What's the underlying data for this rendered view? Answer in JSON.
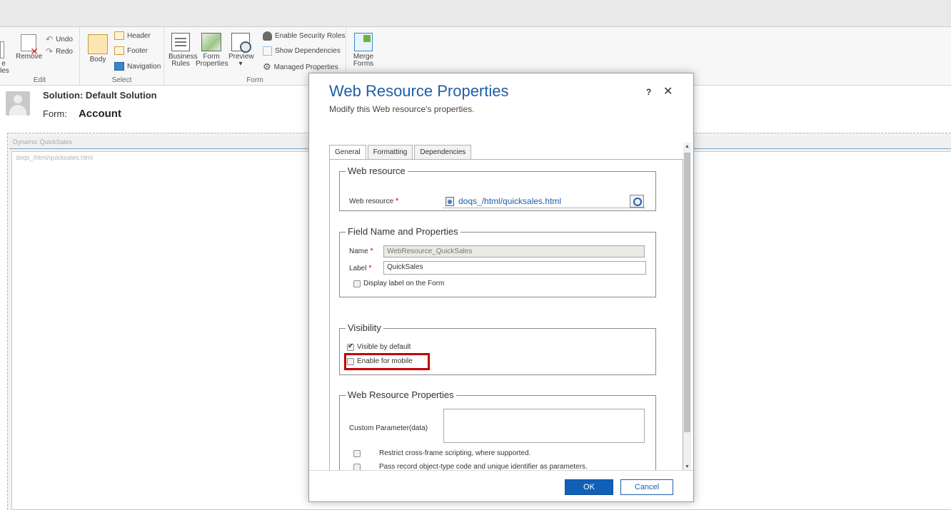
{
  "ribbon": {
    "groups": {
      "edit": "Edit",
      "select": "Select",
      "form": "Form"
    },
    "truncated_left": [
      "e",
      "les"
    ],
    "remove": "Remove",
    "undo": "Undo",
    "redo": "Redo",
    "body": "Body",
    "header": "Header",
    "footer": "Footer",
    "navigation": "Navigation",
    "business_rules": [
      "Business",
      "Rules"
    ],
    "form_properties": [
      "Form",
      "Properties"
    ],
    "preview": "Preview",
    "preview_arrow": "▾",
    "enable_security_roles": "Enable Security Roles",
    "show_dependencies": "Show Dependencies",
    "managed_properties": "Managed Properties",
    "merge_forms": [
      "Merge",
      "Forms"
    ]
  },
  "solution": {
    "solution_line": "Solution: Default Solution",
    "form_label": "Form:",
    "form_name": "Account"
  },
  "canvas": {
    "section_label": "Dynamic QuickSales",
    "webresource_label": "doqs_/html/quicksales.html"
  },
  "dialog": {
    "title": "Web Resource Properties",
    "subtitle": "Modify this Web resource's properties.",
    "help": "?",
    "close": "✕",
    "tabs": [
      {
        "label": "General",
        "active": true
      },
      {
        "label": "Formatting",
        "active": false
      },
      {
        "label": "Dependencies",
        "active": false
      }
    ],
    "web_resource_section": {
      "legend": "Web resource",
      "field_label": "Web resource",
      "value": "doqs_/html/quicksales.html"
    },
    "field_name_section": {
      "legend": "Field Name and Properties",
      "name_label": "Name",
      "name_value": "WebResource_QuickSales",
      "label_label": "Label",
      "label_value": "QuickSales",
      "display_label": "Display label on the Form",
      "display_label_checked": false
    },
    "visibility_section": {
      "legend": "Visibility",
      "visible_by_default": "Visible by default",
      "visible_checked": true,
      "enable_mobile": "Enable for mobile",
      "enable_mobile_checked": false
    },
    "wr_properties_section": {
      "legend": "Web Resource Properties",
      "custom_param_label": "Custom Parameter(data)",
      "custom_param_value": "",
      "restrict_label": "Restrict cross-frame scripting, where supported.",
      "pass_label": "Pass record object-type code and unique identifier as parameters."
    },
    "required_marker": "*",
    "scroll_up": "▲",
    "scroll_down": "▼",
    "ok": "OK",
    "cancel": "Cancel"
  }
}
